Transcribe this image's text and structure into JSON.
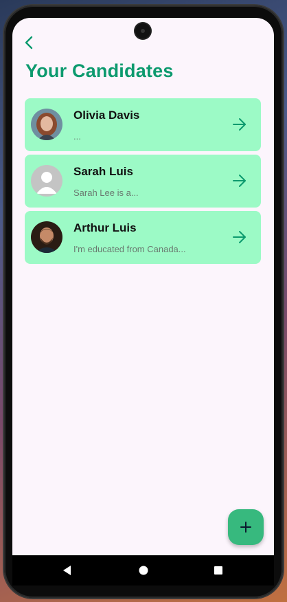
{
  "status_bar": {
    "time": "",
    "icons": ""
  },
  "header": {
    "back_icon": "chevron-left-icon",
    "title": "Your Candidates"
  },
  "candidates": [
    {
      "name": "Olivia Davis",
      "summary": "...",
      "avatar": "photo-woman"
    },
    {
      "name": "Sarah Luis",
      "summary": "Sarah Lee is a...",
      "avatar": "placeholder-person"
    },
    {
      "name": "Arthur Luis",
      "summary": "I'm educated from Canada...",
      "avatar": "photo-man"
    }
  ],
  "fab": {
    "icon": "plus-icon"
  },
  "nav": {
    "back": "nav-back-icon",
    "home": "nav-home-icon",
    "recents": "nav-recents-icon"
  },
  "colors": {
    "accent": "#0c9a6e",
    "card_bg": "#9cfac6",
    "screen_bg": "#fcf5fc",
    "fab_bg": "#37b97e"
  }
}
